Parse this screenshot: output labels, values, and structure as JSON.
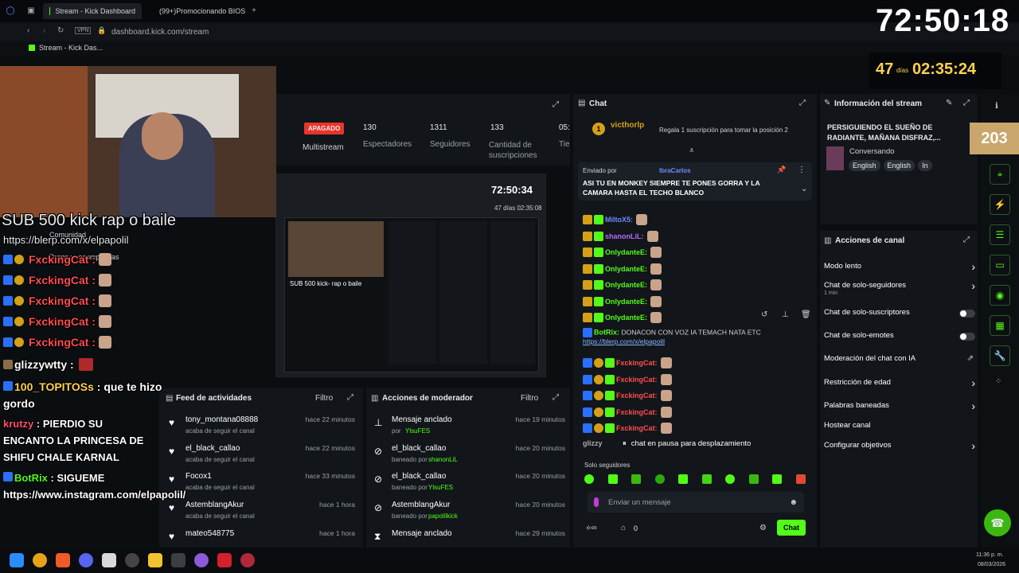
{
  "browser": {
    "tabs": [
      {
        "label": "Stream - Kick Dashboard",
        "active": true
      },
      {
        "label": "(99+)Promocionando BIOS",
        "active": false
      }
    ],
    "address": "dashboard.kick.com/stream",
    "vpn_label": "VPN",
    "bookmark_label": "Stream - Kick Das..."
  },
  "stats": {
    "status_badge": "APAGADO",
    "multistream_label": "Multistream",
    "viewers_value": "130",
    "viewers_label": "Espectadores",
    "followers_value": "1311",
    "followers_label": "Seguidores",
    "subs_value": "133",
    "subs_label": "Cantidad de suscripciones",
    "time_value": "05:",
    "time_label": "Tie"
  },
  "preview": {
    "clock": "72:50:34",
    "clock_small": "47 días 02:35:08",
    "overlay_text": "SUB 500 kick- rap o baile"
  },
  "activity_feed": {
    "title": "Feed de actividades",
    "filter_label": "Filtro",
    "items": [
      {
        "user": "tony_montana08888",
        "desc": "acaba de seguir el canal",
        "time": "hace 22 minutos"
      },
      {
        "user": "el_black_callao",
        "desc": "acaba de seguir el canal",
        "time": "hace 22 minutos"
      },
      {
        "user": "Focox1",
        "desc": "acaba de seguir el canal",
        "time": "hace 33 minutos"
      },
      {
        "user": "AstemblangAkur",
        "desc": "acaba de seguir el canal",
        "time": "hace 1 hora"
      },
      {
        "user": "mateo548775",
        "desc": "",
        "time": "hace 1 hora"
      }
    ]
  },
  "mod_actions": {
    "title": "Acciones de moderador",
    "filter_label": "Filtro",
    "items": [
      {
        "icon": "pin-icon",
        "action": "Mensaje anclado",
        "by_prefix": "por",
        "by": "YlsuFES",
        "time": "hace 19 minutos"
      },
      {
        "icon": "ban-icon",
        "action": "el_black_callao",
        "by_prefix": "baneado por",
        "by": "shanonLiL",
        "time": "hace 20 minutos"
      },
      {
        "icon": "ban-icon",
        "action": "el_black_callao",
        "by_prefix": "baneado por",
        "by": "YlsuFES",
        "time": "hace 20 minutos"
      },
      {
        "icon": "ban-icon",
        "action": "AstemblangAkur",
        "by_prefix": "baneado por",
        "by": "papolilkick",
        "time": "hace 20 minutos"
      },
      {
        "icon": "hourglass-icon",
        "action": "Mensaje anclado",
        "by_prefix": "",
        "by": "",
        "time": "hace 29 minutos"
      }
    ]
  },
  "chat": {
    "title": "Chat",
    "gifter": {
      "name": "victhorlp",
      "rank": "1",
      "message": "Regala 1 suscripción para tomar la posición 2"
    },
    "pinned": {
      "sent_by_label": "Enviado por",
      "user": "IbraCarlos",
      "message": "ASI TU EN MONKEY SIEMPRE TE PONES GORRA Y LA CAMARA HASTA EL TECHO BLANCO"
    },
    "lines": [
      {
        "user": "MiltoX5:",
        "color": "#6b8cff",
        "text": ""
      },
      {
        "user": "shanonLiL:",
        "color": "#b36bff",
        "text": ""
      },
      {
        "user": "OnlydanteE:",
        "color": "#53fc18",
        "text": ""
      },
      {
        "user": "OnlydanteE:",
        "color": "#53fc18",
        "text": ""
      },
      {
        "user": "OnlydanteE:",
        "color": "#53fc18",
        "text": ""
      },
      {
        "user": "OnlydanteE:",
        "color": "#53fc18",
        "text": ""
      },
      {
        "user": "OnlydanteE:",
        "color": "#53fc18",
        "text": ""
      }
    ],
    "botrix": {
      "user": "BotRix:",
      "text": "DONACON CON VOZ IA TEMACH NATA ETC",
      "link": "https://blerp.com/x/elpapolil"
    },
    "fxlines": [
      "FxckingCat:",
      "FxckingCat:",
      "FxckingCat:",
      "FxckingCat:",
      "FxckingCat:"
    ],
    "paused_user": "glizzy",
    "paused_label": "chat en pausa para desplazamiento",
    "followers_only_label": "Solo seguidores",
    "input_placeholder": "Enviar un mensaje",
    "count_value": "0",
    "send_label": "Chat"
  },
  "stream_info": {
    "title": "Información del stream",
    "stream_title": "PERSIGUIENDO EL SUEÑO DE RADIANTE, MAÑANA DISFRAZ,...",
    "category": "Conversando",
    "tags": [
      "English",
      "English",
      "In"
    ],
    "count_badge": "203"
  },
  "channel_actions": {
    "title": "Acciones de canal",
    "items": [
      {
        "label": "Modo lento",
        "sub": "",
        "control": "chevron"
      },
      {
        "label": "Chat de solo-seguidores",
        "sub": "1 min",
        "control": "chevron"
      },
      {
        "label": "Chat de solo-suscriptores",
        "sub": "",
        "control": "toggle"
      },
      {
        "label": "Chat de solo-emotes",
        "sub": "",
        "control": "toggle"
      },
      {
        "label": "Moderación del chat con IA",
        "sub": "",
        "control": "external"
      },
      {
        "label": "Restricción de edad",
        "sub": "",
        "control": "chevron"
      },
      {
        "label": "Palabras baneadas",
        "sub": "",
        "control": "chevron"
      },
      {
        "label": "Hostear canal",
        "sub": "",
        "control": "none"
      },
      {
        "label": "Configurar objetivos",
        "sub": "",
        "control": "chevron"
      }
    ]
  },
  "overlay": {
    "big_clock": "72:50:18",
    "days_value": "47",
    "days_label": "días",
    "small_clock": "02:35:24",
    "title_line": "SUB 500 kick  rap o  baile",
    "link_line": "https://blerp.com/x/elpapolil",
    "community_label": "Comunidad",
    "rewards_label": "Drops y recompensas",
    "fx_user": "FxckingCat :",
    "glizzy_user": "glizzywtty :",
    "topitos_user": "100_TOPITOSs",
    "topitos_text": ": que te hizo gordo",
    "krutzy_user": "krutzy",
    "krutzy_text": ": PIERDIO SU ENCANTO LA PRINCESA DE SHIFU CHALE KARNAL",
    "botrix_user": "BotRix",
    "botrix_text": ": SIGUEME https://www.instagram.com/elpapolil/"
  },
  "taskbar": {
    "time": "11:36 p. m.",
    "date": "08/03/2026"
  },
  "colors": {
    "accent": "#53fc18",
    "danger": "#e8352b",
    "bg": "#0b0e11"
  }
}
